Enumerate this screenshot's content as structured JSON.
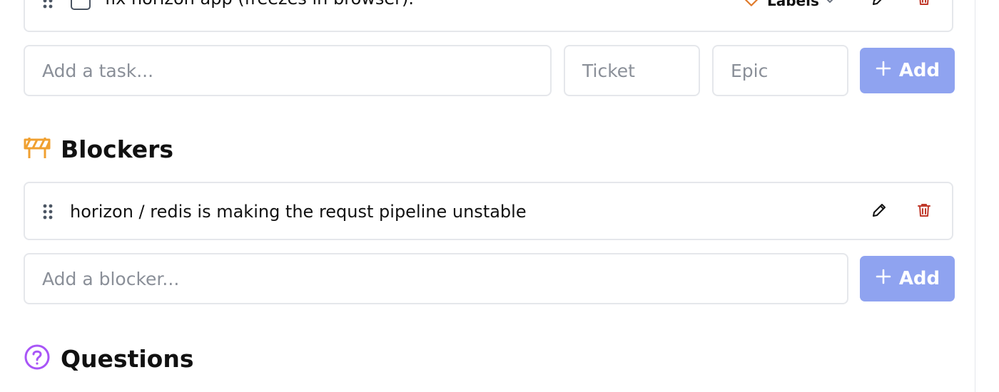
{
  "tasks": {
    "items": [
      {
        "text": "fix horizon app (freezes in browser).",
        "labels_label": "Labels",
        "checked": false
      }
    ],
    "add": {
      "task_placeholder": "Add a task...",
      "ticket_placeholder": "Ticket",
      "epic_placeholder": "Epic",
      "button_label": "Add"
    }
  },
  "blockers": {
    "title": "Blockers",
    "items": [
      {
        "text": "horizon / redis is making the requst pipeline unstable"
      }
    ],
    "add": {
      "placeholder": "Add a blocker...",
      "button_label": "Add"
    }
  },
  "questions": {
    "title": "Questions"
  },
  "icons": {
    "drag": "drag-handle-icon",
    "labels": "tag-icon",
    "chevron": "chevron-down-icon",
    "edit": "pencil-icon",
    "delete": "trash-icon",
    "blockers": "barrier-icon",
    "questions": "question-circle-icon",
    "add": "plus-icon"
  },
  "colors": {
    "accent_button": "#8fa3f0",
    "delete_red": "#c0392b",
    "blocker_orange": "#f0a030",
    "question_purple": "#a855f7",
    "tag_orange": "#e07a2a"
  }
}
